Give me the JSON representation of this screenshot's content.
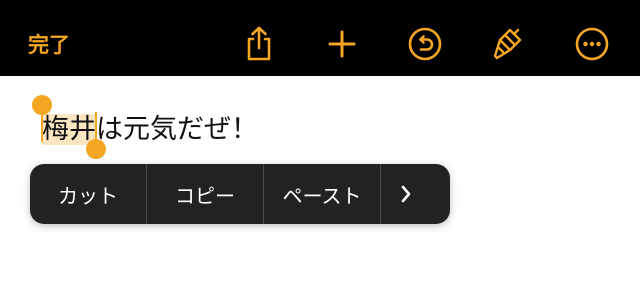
{
  "toolbar": {
    "done_label": "完了",
    "icons": [
      "share-icon",
      "add-icon",
      "undo-icon",
      "paintbrush-icon",
      "more-icon"
    ],
    "accent_color": "#f5a623",
    "background_color": "#000000"
  },
  "document": {
    "selected_text": "梅井",
    "remaining_text": "は元気だぜ！"
  },
  "context_menu": {
    "items": [
      "カット",
      "コピー",
      "ペースト"
    ],
    "more_icon": "chevron-right-icon"
  }
}
